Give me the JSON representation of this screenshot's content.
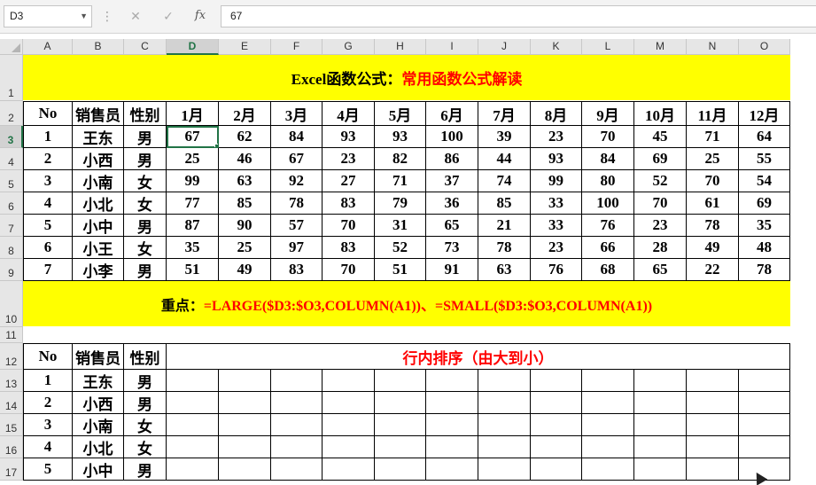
{
  "formula_bar": {
    "name_box": "D3",
    "cancel_icon": "✕",
    "enter_icon": "✓",
    "fx_label": "fx",
    "formula": "67"
  },
  "columns": [
    "A",
    "B",
    "C",
    "D",
    "E",
    "F",
    "G",
    "H",
    "I",
    "J",
    "K",
    "L",
    "M",
    "N",
    "O"
  ],
  "selected_column": "D",
  "rows": [
    "1",
    "2",
    "3",
    "4",
    "5",
    "6",
    "7",
    "8",
    "9",
    "10",
    "11",
    "12",
    "13",
    "14",
    "15",
    "16",
    "17"
  ],
  "selected_row": "3",
  "title": {
    "part1": "Excel函数公式：",
    "part2": "常用函数公式解读"
  },
  "table1": {
    "headers": [
      "No",
      "销售员",
      "性别",
      "1月",
      "2月",
      "3月",
      "4月",
      "5月",
      "6月",
      "7月",
      "8月",
      "9月",
      "10月",
      "11月",
      "12月"
    ],
    "rows": [
      [
        "1",
        "王东",
        "男",
        "67",
        "62",
        "84",
        "93",
        "93",
        "100",
        "39",
        "23",
        "70",
        "45",
        "71",
        "64"
      ],
      [
        "2",
        "小西",
        "男",
        "25",
        "46",
        "67",
        "23",
        "82",
        "86",
        "44",
        "93",
        "84",
        "69",
        "25",
        "55"
      ],
      [
        "3",
        "小南",
        "女",
        "99",
        "63",
        "92",
        "27",
        "71",
        "37",
        "74",
        "99",
        "80",
        "52",
        "70",
        "54"
      ],
      [
        "4",
        "小北",
        "女",
        "77",
        "85",
        "78",
        "83",
        "79",
        "36",
        "85",
        "33",
        "100",
        "70",
        "61",
        "69"
      ],
      [
        "5",
        "小中",
        "男",
        "87",
        "90",
        "57",
        "70",
        "31",
        "65",
        "21",
        "33",
        "76",
        "23",
        "78",
        "35"
      ],
      [
        "6",
        "小王",
        "女",
        "35",
        "25",
        "97",
        "83",
        "52",
        "73",
        "78",
        "23",
        "66",
        "28",
        "49",
        "48"
      ],
      [
        "7",
        "小李",
        "男",
        "51",
        "49",
        "83",
        "70",
        "51",
        "91",
        "63",
        "76",
        "68",
        "65",
        "22",
        "78"
      ]
    ]
  },
  "note": {
    "label": "重点：",
    "formula": "=LARGE($D3:$O3,COLUMN(A1))、=SMALL($D3:$O3,COLUMN(A1))"
  },
  "table2": {
    "headers": [
      "No",
      "销售员",
      "性别"
    ],
    "merged_header": "行内排序（由大到小）",
    "rows": [
      [
        "1",
        "王东",
        "男"
      ],
      [
        "2",
        "小西",
        "男"
      ],
      [
        "3",
        "小南",
        "女"
      ],
      [
        "4",
        "小北",
        "女"
      ],
      [
        "5",
        "小中",
        "男"
      ]
    ]
  }
}
